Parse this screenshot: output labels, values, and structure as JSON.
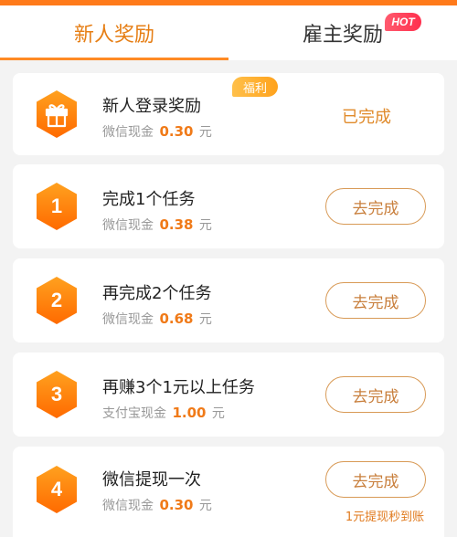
{
  "colors": {
    "accent": "#ff8a24",
    "hex_fill_top": "#ffa11f",
    "hex_fill_bottom": "#ff6a00",
    "amount": "#f07a18",
    "button_border": "#d89a56",
    "hot_badge": "#ff3c56",
    "fuli_badge": "#ffb030"
  },
  "tabs": [
    {
      "label": "新人奖励",
      "active": true
    },
    {
      "label": "雇主奖励",
      "active": false,
      "badge": "HOT"
    }
  ],
  "tasks": [
    {
      "icon": "gift-icon",
      "title": "新人登录奖励",
      "badge": "福利",
      "reward_prefix": "微信现金",
      "amount": "0.30",
      "unit": "元",
      "status": "已完成"
    },
    {
      "number": "1",
      "title": "完成1个任务",
      "reward_prefix": "微信现金",
      "amount": "0.38",
      "unit": "元",
      "button": "去完成"
    },
    {
      "number": "2",
      "title": "再完成2个任务",
      "reward_prefix": "微信现金",
      "amount": "0.68",
      "unit": "元",
      "button": "去完成"
    },
    {
      "number": "3",
      "title": "再赚3个1元以上任务",
      "reward_prefix": "支付宝现金",
      "amount": "1.00",
      "unit": "元",
      "button": "去完成"
    },
    {
      "number": "4",
      "title": "微信提现一次",
      "reward_prefix": "微信现金",
      "amount": "0.30",
      "unit": "元",
      "button": "去完成",
      "note": "1元提现秒到账"
    }
  ]
}
